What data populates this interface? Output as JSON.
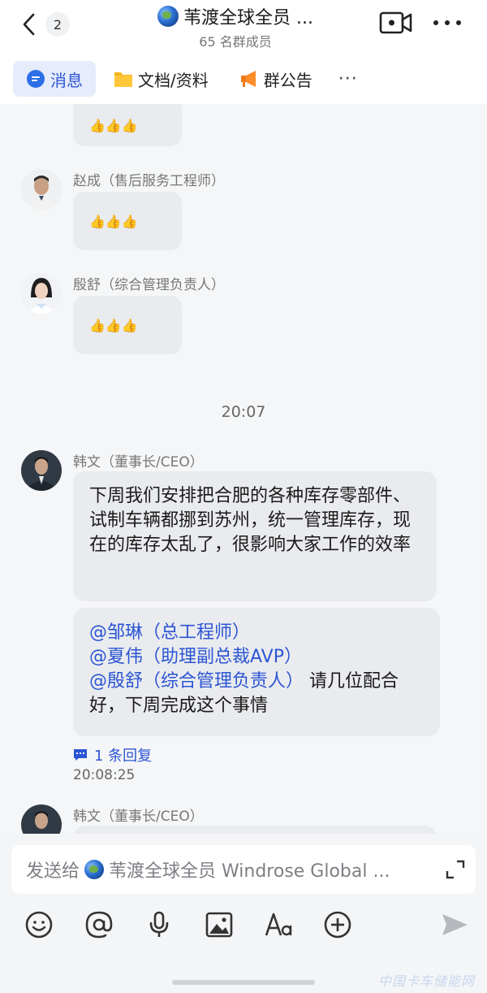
{
  "header": {
    "back_count": "2",
    "group_title": "苇渡全球全员 ...",
    "member_count": "65 名群成员"
  },
  "tabs": [
    {
      "label": "消息",
      "icon": "chat-bubble-icon",
      "active": true
    },
    {
      "label": "文档/资料",
      "icon": "folder-icon",
      "active": false
    },
    {
      "label": "群公告",
      "icon": "megaphone-icon",
      "active": false
    },
    {
      "label": "···",
      "icon": "more-icon",
      "active": false
    }
  ],
  "messages": [
    {
      "sender": "",
      "reactions": "👍👍👍"
    },
    {
      "sender": "赵成（售后服务工程师）",
      "reactions": "👍👍👍"
    },
    {
      "sender": "殷舒（综合管理负责人）",
      "reactions": "👍👍👍"
    }
  ],
  "timestamp": "20:07",
  "main_message": {
    "sender": "韩文（董事长/CEO）",
    "text": "下周我们安排把合肥的各种库存零部件、试制车辆都挪到苏州，统一管理库存，现在的库存太乱了，很影响大家工作的效率",
    "mention_1": "@邹琳（总工程师）",
    "mention_2": "@夏伟（助理副总裁AVP）",
    "mention_3": "@殷舒（综合管理负责人）",
    "mention_tail": " 请几位配合好，下周完成这个事情",
    "reply_link": "1 条回复",
    "reply_time": "20:08:25"
  },
  "next_message": {
    "sender": "韩文（董事长/CEO）"
  },
  "composer": {
    "prefix": "发送给",
    "target": "苇渡全球全员 Windrose Global ..."
  },
  "toolbar": [
    "emoji-icon",
    "at-icon",
    "microphone-icon",
    "image-icon",
    "font-icon",
    "plus-icon",
    "send-icon"
  ],
  "watermark": "中国卡车储能网",
  "colors": {
    "accent": "#2c55d4",
    "bubble": "#e9ebee",
    "background": "#f5f6f7"
  }
}
